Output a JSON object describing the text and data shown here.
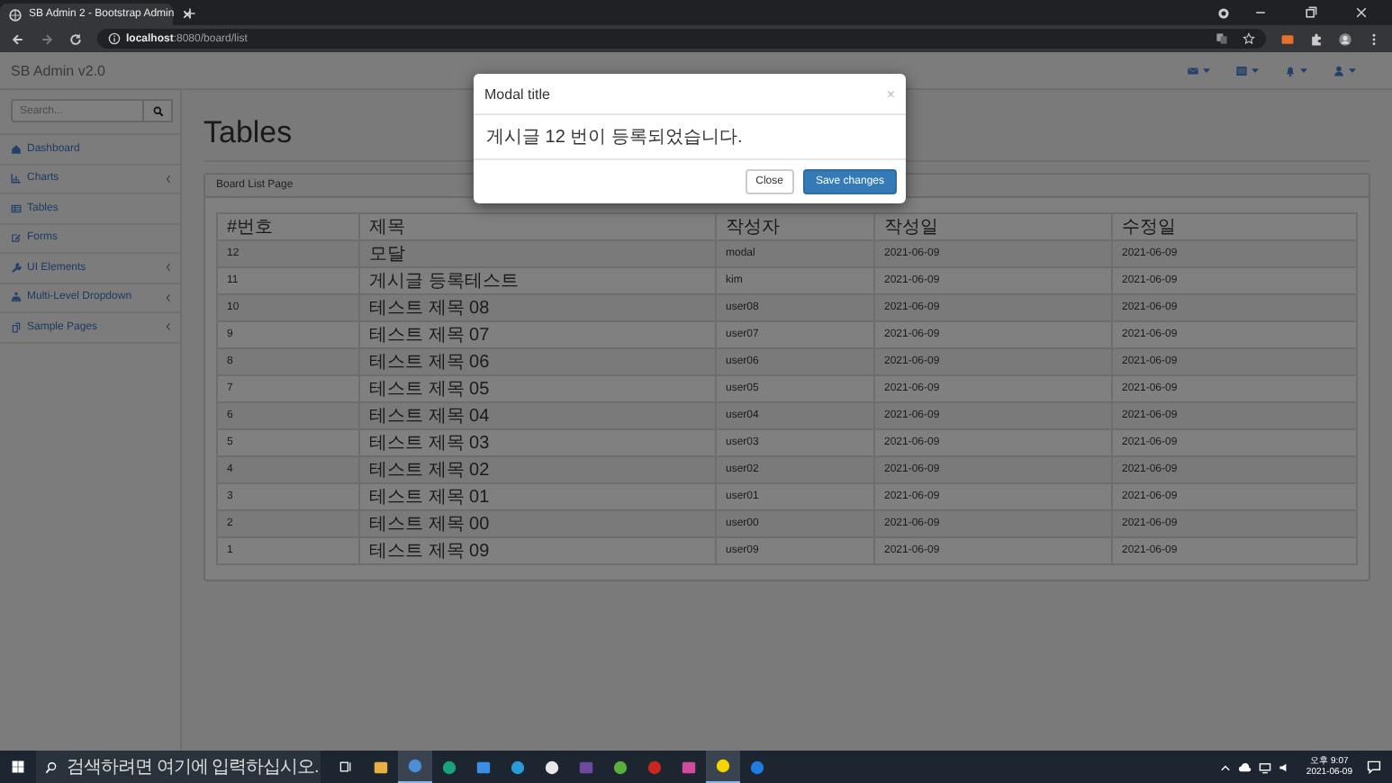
{
  "browser": {
    "tab_title": "SB Admin 2 - Bootstrap Admin",
    "address_host": "localhost",
    "address_path": ":8080/board/list"
  },
  "navbar": {
    "brand": "SB Admin v2.0"
  },
  "sidebar": {
    "search_placeholder": "Search...",
    "items": [
      {
        "label": "Dashboard",
        "has_arrow": false
      },
      {
        "label": "Charts",
        "has_arrow": true
      },
      {
        "label": "Tables",
        "has_arrow": false
      },
      {
        "label": "Forms",
        "has_arrow": false
      },
      {
        "label": "UI Elements",
        "has_arrow": true
      },
      {
        "label": "Multi-Level Dropdown",
        "has_arrow": true
      },
      {
        "label": "Sample Pages",
        "has_arrow": true
      }
    ]
  },
  "page": {
    "title": "Tables",
    "panel_heading": "Board List Page"
  },
  "table": {
    "columns": [
      "#번호",
      "제목",
      "작성자",
      "작성일",
      "수정일"
    ],
    "rows": [
      [
        "12",
        "모달",
        "modal",
        "2021-06-09",
        "2021-06-09"
      ],
      [
        "11",
        "게시글 등록테스트",
        "kim",
        "2021-06-09",
        "2021-06-09"
      ],
      [
        "10",
        "테스트 제목 08",
        "user08",
        "2021-06-09",
        "2021-06-09"
      ],
      [
        "9",
        "테스트 제목 07",
        "user07",
        "2021-06-09",
        "2021-06-09"
      ],
      [
        "8",
        "테스트 제목 06",
        "user06",
        "2021-06-09",
        "2021-06-09"
      ],
      [
        "7",
        "테스트 제목 05",
        "user05",
        "2021-06-09",
        "2021-06-09"
      ],
      [
        "6",
        "테스트 제목 04",
        "user04",
        "2021-06-09",
        "2021-06-09"
      ],
      [
        "5",
        "테스트 제목 03",
        "user03",
        "2021-06-09",
        "2021-06-09"
      ],
      [
        "4",
        "테스트 제목 02",
        "user02",
        "2021-06-09",
        "2021-06-09"
      ],
      [
        "3",
        "테스트 제목 01",
        "user01",
        "2021-06-09",
        "2021-06-09"
      ],
      [
        "2",
        "테스트 제목 00",
        "user00",
        "2021-06-09",
        "2021-06-09"
      ],
      [
        "1",
        "테스트 제목 09",
        "user09",
        "2021-06-09",
        "2021-06-09"
      ]
    ]
  },
  "modal": {
    "title": "Modal title",
    "close_glyph": "×",
    "body": "게시글 12 번이 등록되었습니다.",
    "buttons": [
      {
        "label": "Close",
        "kind": "default"
      },
      {
        "label": "Save changes",
        "kind": "primary"
      }
    ]
  },
  "taskbar": {
    "search_placeholder": "검색하려면 여기에 입력하십시오.",
    "time": "오후 9:07",
    "date": "2021-06-09"
  }
}
